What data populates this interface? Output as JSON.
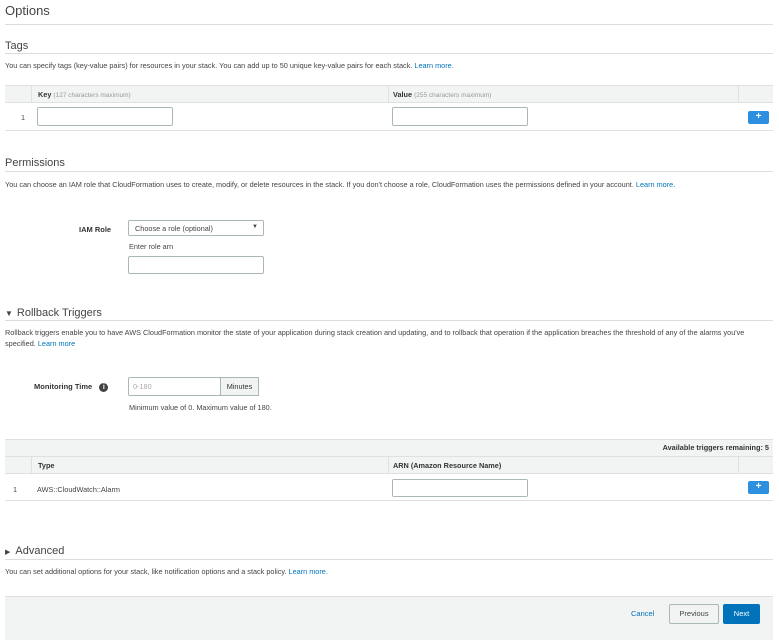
{
  "options": {
    "title": "Options"
  },
  "tags": {
    "title": "Tags",
    "description": "You can specify tags (key-value pairs) for resources in your stack. You can add up to 50 unique key-value pairs for each stack.",
    "learn_more": "Learn more.",
    "columns": {
      "key": "Key",
      "key_hint": "(127 characters maximum)",
      "value": "Value",
      "value_hint": "(255 characters maximum)"
    },
    "rows": [
      {
        "index": "1",
        "key": "",
        "value": ""
      }
    ],
    "add_icon": "plus-icon"
  },
  "permissions": {
    "title": "Permissions",
    "description": "You can choose an IAM role that CloudFormation uses to create, modify, or delete resources in the stack. If you don't choose a role, CloudFormation uses the permissions defined in your account.",
    "learn_more": "Learn more.",
    "iam_role_label": "IAM Role",
    "iam_role_select": "Choose a role (optional)",
    "enter_role_arn_label": "Enter role arn",
    "role_arn_value": ""
  },
  "rollback": {
    "title": "Rollback Triggers",
    "expanded": true,
    "description": "Rollback triggers enable you to have AWS CloudFormation monitor the state of your application during stack creation and updating, and to rollback that operation if the application breaches the threshold of any of the alarms you've specified.",
    "learn_more": "Learn more",
    "monitoring_time_label": "Monitoring Time",
    "monitoring_time_placeholder": "0-180",
    "monitoring_time_unit": "Minutes",
    "monitoring_time_help": "Minimum value of 0. Maximum value of 180.",
    "available_triggers": "Available triggers remaining: 5",
    "columns": {
      "type": "Type",
      "arn": "ARN (Amazon Resource Name)"
    },
    "rows": [
      {
        "index": "1",
        "type": "AWS::CloudWatch::Alarm",
        "arn": ""
      }
    ]
  },
  "advanced": {
    "title": "Advanced",
    "expanded": false,
    "description": "You can set additional options for your stack, like notification options and a stack policy.",
    "learn_more": "Learn more."
  },
  "footer": {
    "cancel": "Cancel",
    "previous": "Previous",
    "next": "Next"
  },
  "colors": {
    "link": "#0073bb",
    "primary_button": "#0073bb",
    "plus_button": "#2d8fdf",
    "table_header_bg": "#f2f3f3"
  }
}
